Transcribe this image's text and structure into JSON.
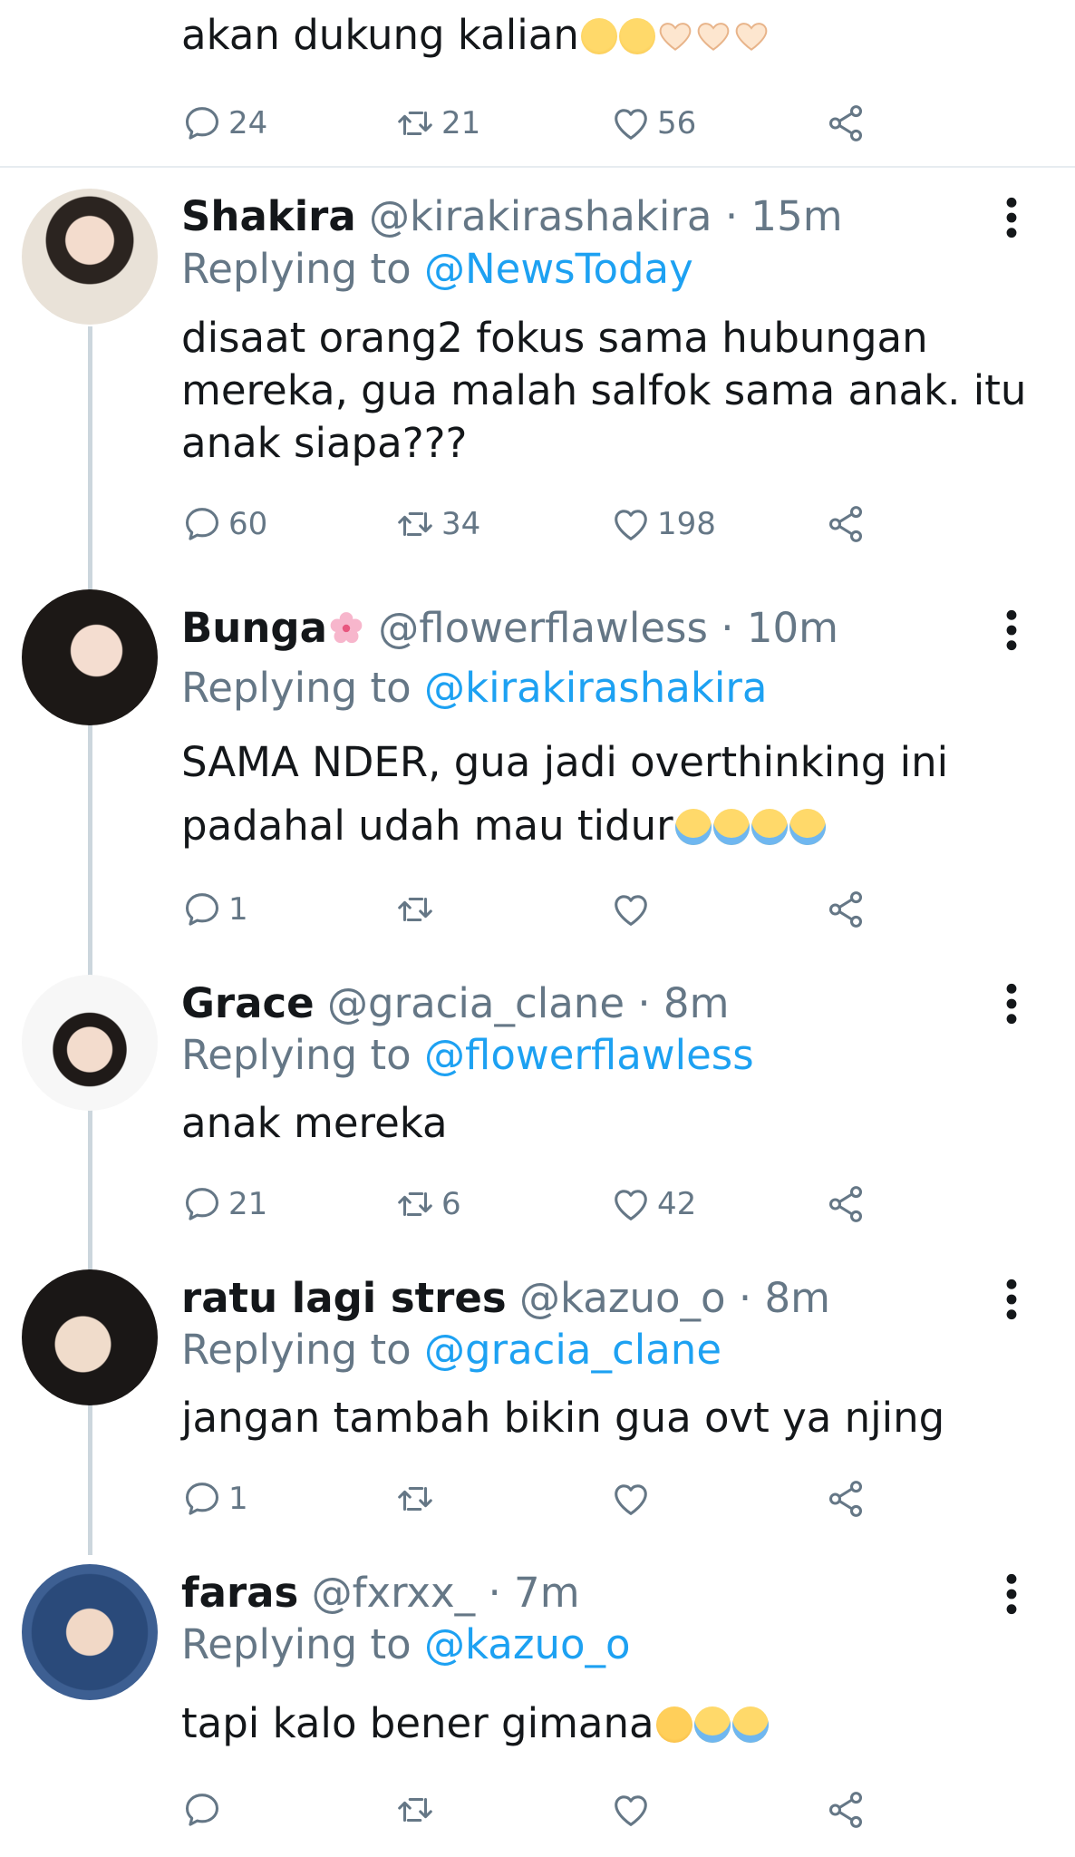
{
  "top_tweet": {
    "text": "akan dukung kalian",
    "emojis": [
      "pleading-face",
      "pleading-face",
      "heart-hands",
      "heart-hands",
      "heart-hands"
    ],
    "replies": "24",
    "retweets": "21",
    "likes": "56"
  },
  "tweets": [
    {
      "name": "Shakira",
      "handle": "@kirakirashakira",
      "time": "· 15m",
      "replying_prefix": "Replying to",
      "replying_to": "@NewsToday",
      "text": "disaat orang2 fokus sama hubungan mereka, gua malah salfok sama anak. itu anak siapa???",
      "replies": "60",
      "retweets": "34",
      "likes": "198"
    },
    {
      "name": "Bunga",
      "handle": "@flowerflawless",
      "time": "· 10m",
      "replying_prefix": "Replying to",
      "replying_to": "@kirakirashakira",
      "text": "SAMA NDER, gua jadi overthinking ini padahal udah mau tidur",
      "emojis": [
        "crying-face",
        "crying-face",
        "crying-face",
        "crying-face"
      ],
      "replies": "1",
      "retweets": "",
      "likes": ""
    },
    {
      "name": "Grace",
      "handle": "@gracia_clane",
      "time": "· 8m",
      "replying_prefix": "Replying to",
      "replying_to": "@flowerflawless",
      "text": "anak mereka",
      "replies": "21",
      "retweets": "6",
      "likes": "42"
    },
    {
      "name": "ratu lagi stres",
      "handle": "@kazuo_o",
      "time": "· 8m",
      "replying_prefix": "Replying to",
      "replying_to": "@gracia_clane",
      "text": "jangan tambah bikin gua ovt ya njing",
      "replies": "1",
      "retweets": "",
      "likes": ""
    },
    {
      "name": "faras",
      "handle": "@fxrxx_",
      "time": "· 7m",
      "replying_prefix": "Replying to",
      "replying_to": "@kazuo_o",
      "text": "tapi kalo bener gimana",
      "emojis": [
        "tired-face",
        "crying-face",
        "crying-face"
      ],
      "replies": "",
      "retweets": "",
      "likes": ""
    }
  ],
  "colors": {
    "link": "#1da1f2",
    "secondary": "#657786",
    "text": "#14171a",
    "thread": "#ccd6dd"
  }
}
